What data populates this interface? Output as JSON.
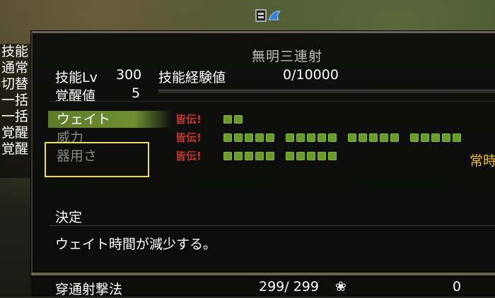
{
  "panel": {
    "title": "無明三連射",
    "skill_level_label": "技能Lv",
    "skill_level_value": "300",
    "exp_label": "技能経験値",
    "exp_value": "0/10000",
    "awaken_label": "覚醒値",
    "awaken_value": "5"
  },
  "left_list": [
    "技能",
    "通常",
    "切替",
    "一括",
    "一括",
    "覚醒",
    "覚醒"
  ],
  "stats": [
    {
      "label": "ウェイト",
      "badge": "皆伝!",
      "pips": 2,
      "selected": true
    },
    {
      "label": "威力",
      "badge": "皆伝!",
      "pips": 20,
      "selected": false
    },
    {
      "label": "器用さ",
      "badge": "皆伝!",
      "pips": 10,
      "selected": false
    }
  ],
  "right_text": "常時",
  "decide_label": "決定",
  "description": "ウェイト時間が減少する。",
  "bottom": {
    "name": "穿通射撃法",
    "value": "299/ 299",
    "flower_icon": "❀",
    "count": "0"
  },
  "colors": {
    "selected_bar": "#6e8f30",
    "badge": "#c0392b",
    "pip": "#6a9a2a",
    "highlight_box": "#f0e040",
    "right_text": "#f0c020"
  }
}
